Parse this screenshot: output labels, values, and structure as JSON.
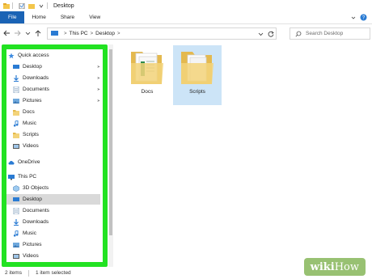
{
  "window": {
    "title": "Desktop"
  },
  "ribbon": {
    "tabs": [
      "File",
      "Home",
      "Share",
      "View"
    ]
  },
  "address": {
    "crumbs": [
      "This PC",
      "Desktop"
    ]
  },
  "search": {
    "placeholder": "Search Desktop"
  },
  "sidebar": {
    "quick_access": "Quick access",
    "quick_items": [
      "Desktop",
      "Downloads",
      "Documents",
      "Pictures",
      "Docs",
      "Music",
      "Scripts",
      "Videos"
    ],
    "onedrive": "OneDrive",
    "this_pc": "This PC",
    "pc_items": [
      "3D Objects",
      "Desktop",
      "Documents",
      "Downloads",
      "Music",
      "Pictures",
      "Videos"
    ]
  },
  "content": {
    "folders": [
      {
        "name": "Docs",
        "selected": false
      },
      {
        "name": "Scripts",
        "selected": true
      }
    ]
  },
  "status": {
    "count": "2 items",
    "selection": "1 item selected"
  },
  "watermark": {
    "part1": "wiki",
    "part2": "How"
  },
  "colors": {
    "file_tab": "#1a63b5",
    "highlight": "#22e222",
    "selection": "#cce4f7",
    "folder": "#f3d37a"
  }
}
